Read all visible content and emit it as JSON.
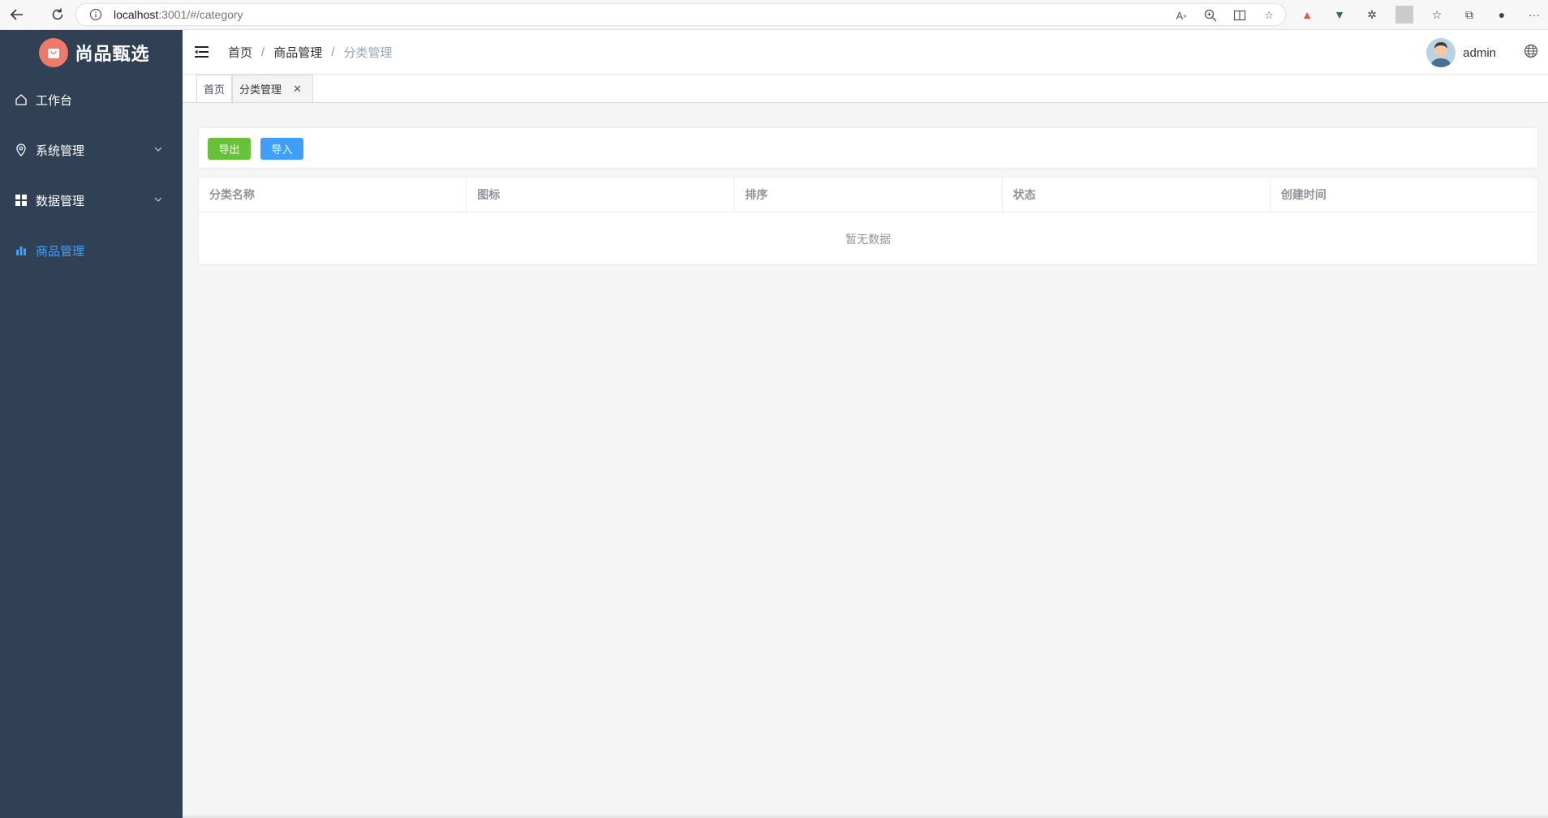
{
  "browser": {
    "url_host": "localhost",
    "url_rest": ":3001/#/category"
  },
  "app": {
    "title": "尚品甄选"
  },
  "sidebar": {
    "items": [
      {
        "label": "工作台",
        "icon": "home-icon"
      },
      {
        "label": "系统管理",
        "icon": "location-icon"
      },
      {
        "label": "数据管理",
        "icon": "grid-icon"
      },
      {
        "label": "商品管理",
        "icon": "bar-chart-icon"
      }
    ]
  },
  "header": {
    "breadcrumb": [
      "首页",
      "商品管理",
      "分类管理"
    ],
    "username": "admin"
  },
  "tags": {
    "home": "首页",
    "current": "分类管理",
    "close_glyph": "✕"
  },
  "toolbar": {
    "export_label": "导出",
    "import_label": "导入"
  },
  "table": {
    "columns": [
      "分类名称",
      "图标",
      "排序",
      "状态",
      "创建时间"
    ],
    "empty_text": "暂无数据"
  },
  "colors": {
    "sidebar_bg": "#304156",
    "active": "#409eff",
    "export_btn": "#67c23a",
    "import_btn": "#409eff",
    "logo": "#ee7a6b"
  }
}
